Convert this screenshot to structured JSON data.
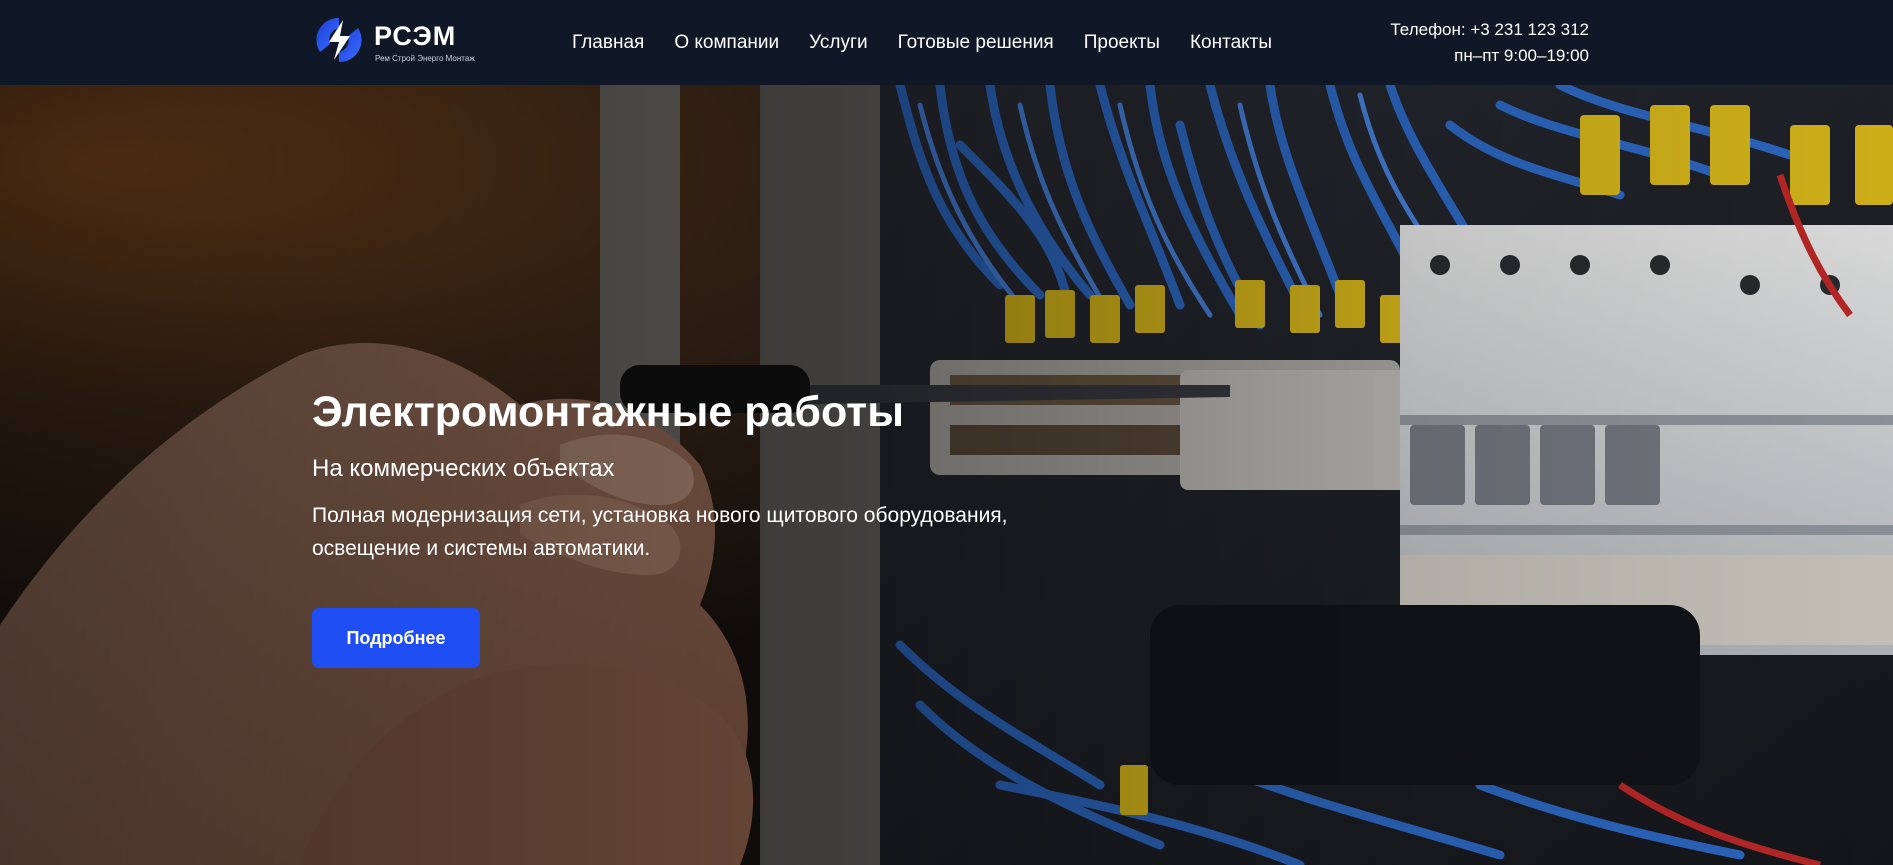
{
  "brand": {
    "name": "РСЭМ",
    "tagline": "Рем Строй Энерго Монтаж",
    "logo_icon": "lightning-logo-icon",
    "accent_color": "#1f4ff2"
  },
  "nav": {
    "items": [
      {
        "label": "Главная"
      },
      {
        "label": "О компании"
      },
      {
        "label": "Услуги"
      },
      {
        "label": "Готовые решения"
      },
      {
        "label": "Проекты"
      },
      {
        "label": "Контакты"
      }
    ]
  },
  "contact": {
    "phone": "Телефон: +3 231 123 312",
    "hours": "пн–пт 9:00–19:00"
  },
  "hero": {
    "title": "Электромонтажные работы",
    "subtitle": "На коммерческих объектах",
    "description": "Полная модернизация сети, установка нового щитового оборудования, освещение и системы автоматики.",
    "button_label": "Подробнее",
    "background_image": "electrical-panel-wiring-photo"
  },
  "colors": {
    "header_bg": "#101828",
    "button_bg": "#1f4ff2",
    "text": "#ffffff"
  }
}
